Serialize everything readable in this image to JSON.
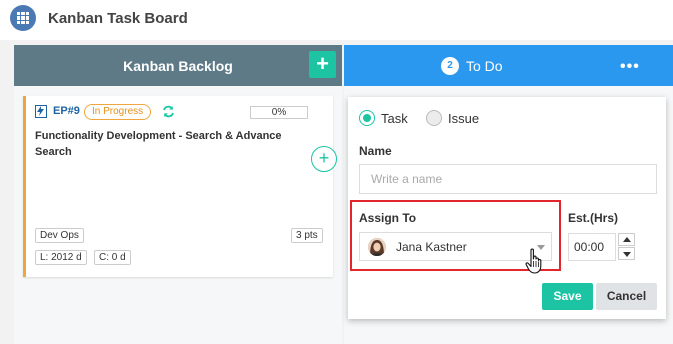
{
  "header": {
    "title": "Kanban Task Board",
    "app_icon": "grid-icon"
  },
  "columns": [
    {
      "title": "Kanban Backlog",
      "add_label": "+",
      "header_color": "#5f7a87"
    },
    {
      "title": "To Do",
      "count": "2",
      "more_label": "•••",
      "header_color": "#2b98f0"
    }
  ],
  "card": {
    "type_icon": "bolt-icon",
    "id": "EP#9",
    "status": "In Progress",
    "progress": "0%",
    "title": "Functionality Development - Search & Advance Search",
    "add_label": "+",
    "tags": {
      "team": "Dev Ops",
      "points": "3 pts",
      "lead": "L: 2012 d",
      "cycle": "C: 0 d"
    },
    "accent_color": "#f0a640"
  },
  "form": {
    "type_options": [
      "Task",
      "Issue"
    ],
    "selected_type": "Task",
    "name_label": "Name",
    "name_value": "",
    "name_placeholder": "Write a name",
    "assign_label": "Assign To",
    "assign_value": "Jana Kastner",
    "est_label": "Est.(Hrs)",
    "est_value": "00:00",
    "save_label": "Save",
    "cancel_label": "Cancel"
  },
  "colors": {
    "accent": "#1cc4a3",
    "highlight": "#e3262d"
  }
}
